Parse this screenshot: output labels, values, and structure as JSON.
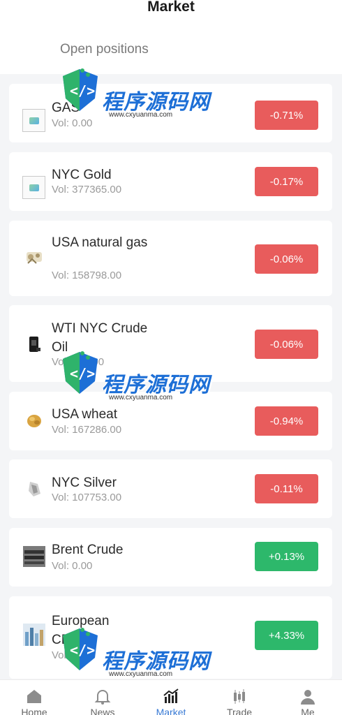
{
  "header": {
    "title": "Market",
    "tab_open": "Open positions"
  },
  "colors": {
    "down": "#e85c5c",
    "up": "#2db86b",
    "accent": "#3a7bd5"
  },
  "rows": [
    {
      "name": "GAS",
      "vol": "Vol:  0.00",
      "change": "-0.71%",
      "direction": "down",
      "thumb": "broken-image-icon"
    },
    {
      "name": "NYC Gold",
      "vol": "Vol:  377365.00",
      "change": "-0.17%",
      "direction": "down",
      "thumb": "broken-image-icon"
    },
    {
      "name": "USA natural gas",
      "vol": "Vol:  158798.00",
      "change": "-0.06%",
      "direction": "down",
      "thumb": "gas-icon"
    },
    {
      "name": "WTI NYC Crude Oil",
      "vol": "Vol:  246.00",
      "change": "-0.06%",
      "direction": "down",
      "thumb": "oil-icon"
    },
    {
      "name": "USA wheat",
      "vol": "Vol:  167286.00",
      "change": "-0.94%",
      "direction": "down",
      "thumb": "wheat-icon"
    },
    {
      "name": "NYC Silver",
      "vol": "Vol:  107753.00",
      "change": "-0.11%",
      "direction": "down",
      "thumb": "silver-icon"
    },
    {
      "name": "Brent Crude",
      "vol": "Vol:  0.00",
      "change": "+0.13%",
      "direction": "up",
      "thumb": "pipe-icon"
    },
    {
      "name": "European CE",
      "vol": "Vol",
      "change": "+4.33%",
      "direction": "up",
      "thumb": "city-icon"
    }
  ],
  "watermark": {
    "text": "程序源码网",
    "url": "www.cxyuanma.com"
  },
  "nav": [
    {
      "label": "Home",
      "icon": "home-icon"
    },
    {
      "label": "News",
      "icon": "bell-icon"
    },
    {
      "label": "Market",
      "icon": "chart-icon",
      "active": true
    },
    {
      "label": "Trade",
      "icon": "candlestick-icon"
    },
    {
      "label": "Me",
      "icon": "user-icon"
    }
  ]
}
